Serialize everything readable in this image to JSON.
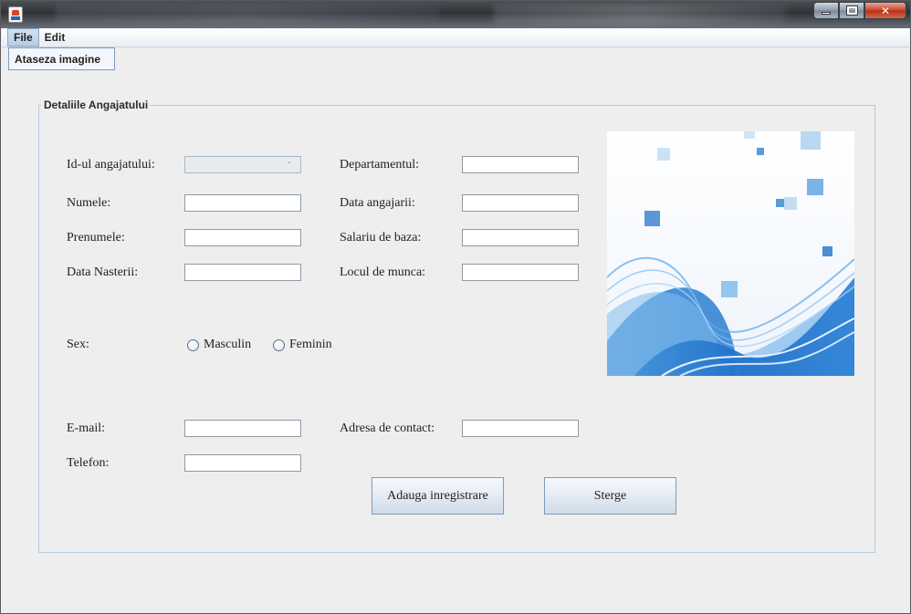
{
  "window": {
    "controls": {
      "minimize": "",
      "maximize": "",
      "close": "✕"
    }
  },
  "menubar": {
    "items": [
      {
        "label": "File"
      },
      {
        "label": "Edit"
      }
    ],
    "file_dropdown": {
      "items": [
        {
          "label": "Ataseza imagine"
        }
      ]
    }
  },
  "panel": {
    "title": "Detaliile Angajatului",
    "labels": {
      "id": "Id-ul angajatului:",
      "departament": "Departamentul:",
      "numele": "Numele:",
      "data_angajarii": "Data angajarii:",
      "prenumele": "Prenumele:",
      "salariu": "Salariu de baza:",
      "data_nasterii": "Data Nasterii:",
      "locul_de_munca": "Locul de munca:",
      "sex": "Sex:",
      "email": "E-mail:",
      "adresa": "Adresa de contact:",
      "telefon": "Telefon:"
    },
    "fields": {
      "id": "",
      "departament": "",
      "numele": "",
      "data_angajarii": "",
      "prenumele": "",
      "salariu": "",
      "data_nasterii": "",
      "locul_de_munca": "",
      "email": "",
      "adresa": "",
      "telefon": ""
    },
    "sex_options": {
      "masculin": "Masculin",
      "feminin": "Feminin"
    },
    "buttons": {
      "add": "Adauga inregistrare",
      "delete": "Sterge"
    }
  },
  "colors": {
    "accent": "#2a7fd0",
    "panel_border": "#b5c8dc"
  }
}
